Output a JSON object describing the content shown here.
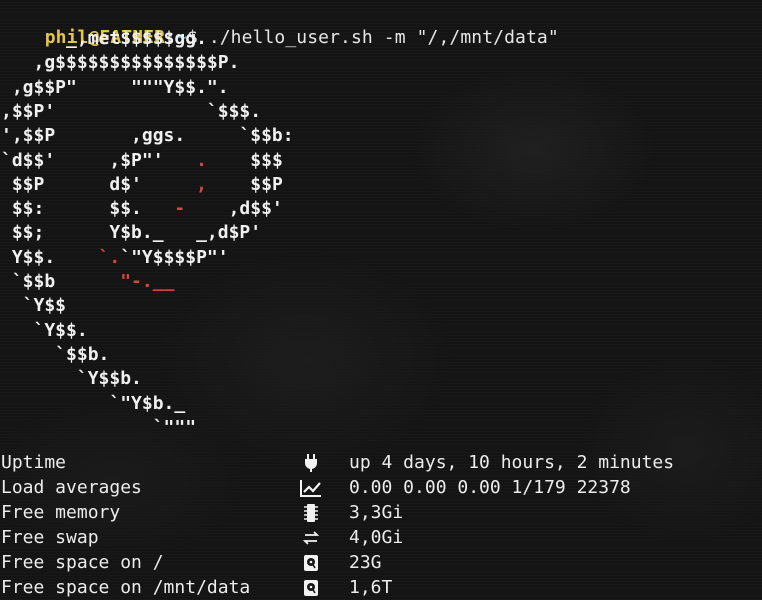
{
  "prompt": {
    "user_host": "phil@FATHER",
    "separator": ":",
    "path": "~",
    "symbol": "$ ",
    "command": "./hello_user.sh -m \"/,/mnt/data\""
  },
  "logo": [
    [
      "      _,met$$$$$gg."
    ],
    [
      "   ,g$$$$$$$$$$$$$$$P."
    ],
    [
      " ,g$$P\"     \"\"\"Y$$.\"."
    ],
    [
      ",$$P'              `$$$."
    ],
    [
      "',$$P       ,ggs.     `$$b:"
    ],
    [
      "`d$$'     ,$P\"'   ",
      ".",
      "    $$$"
    ],
    [
      " $$P      d$'     ",
      ",",
      "    $$P"
    ],
    [
      " $$:      $$.   ",
      "-",
      "    ,d$$'"
    ],
    [
      " $$;      Y$b._   _,d$P'"
    ],
    [
      " Y$$.    ",
      "`.",
      "`\"Y$$$$P\"'"
    ],
    [
      " `$$b      ",
      "\"-.__",
      ""
    ],
    [
      "  `Y$$"
    ],
    [
      "   `Y$$."
    ],
    [
      "     `$$b."
    ],
    [
      "       `Y$$b."
    ],
    [
      "          `\"Y$b._"
    ],
    [
      "              `\"\"\""
    ]
  ],
  "stats": [
    {
      "label": "Uptime",
      "icon": "plug-icon",
      "value": "up 4 days, 10 hours, 2 minutes"
    },
    {
      "label": "Load averages",
      "icon": "chart-line-icon",
      "value": "0.00 0.00 0.00 1/179 22378"
    },
    {
      "label": "Free memory",
      "icon": "memory-chip-icon",
      "value": "3,3Gi"
    },
    {
      "label": "Free swap",
      "icon": "swap-arrows-icon",
      "value": "4,0Gi"
    },
    {
      "label": "Free space on /",
      "icon": "harddisk-icon",
      "value": "23G"
    },
    {
      "label": "Free space on /mnt/data",
      "icon": "harddisk-icon",
      "value": "1,6T"
    }
  ],
  "colors": {
    "background": "#141414",
    "prompt_user": "#e2c64a",
    "prompt_path": "#4aa0e0",
    "logo_accent": "#d8453c",
    "text": "#e6e6e6"
  }
}
